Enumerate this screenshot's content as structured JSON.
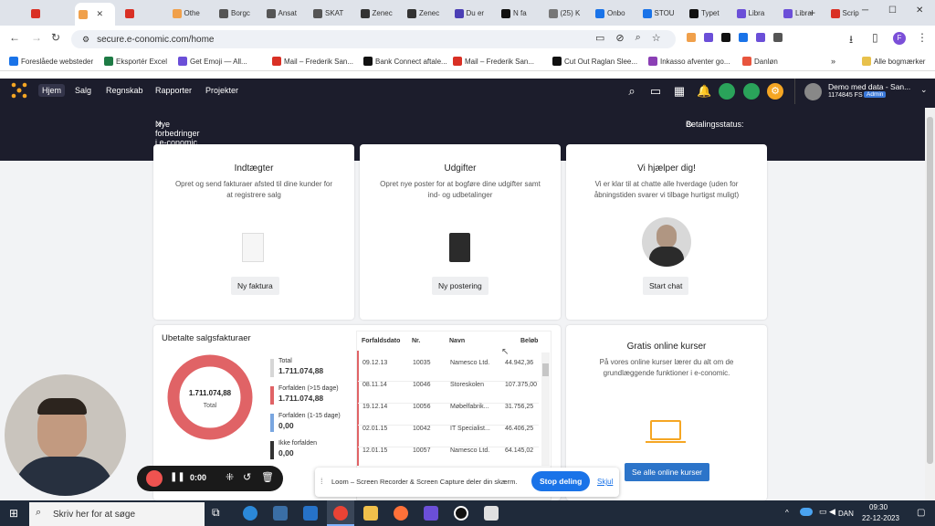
{
  "browser": {
    "tabs": [
      {
        "label": "",
        "icon": "gear-icon",
        "color": "#d93025"
      },
      {
        "label": "",
        "icon": "close-icon",
        "color": "#f0a04b"
      },
      {
        "label": "",
        "icon": "record-icon",
        "color": "#d93025"
      },
      {
        "label": "Othe",
        "icon": "office-icon",
        "color": "#f0a04b"
      },
      {
        "label": "Borgc",
        "icon": "link-icon",
        "color": "#555"
      },
      {
        "label": "Ansat",
        "icon": "link-icon",
        "color": "#555"
      },
      {
        "label": "SKAT",
        "icon": "link-icon",
        "color": "#555"
      },
      {
        "label": "Zenec",
        "icon": "zendesk-icon",
        "color": "#333"
      },
      {
        "label": "Zenec",
        "icon": "zendesk-icon",
        "color": "#333"
      },
      {
        "label": "Du er",
        "icon": "clover-icon",
        "color": "#4b3fb5"
      },
      {
        "label": "N fa",
        "icon": "n-icon",
        "color": "#111"
      },
      {
        "label": "(25) K",
        "icon": "globe-icon",
        "color": "#777"
      },
      {
        "label": "Onbo",
        "icon": "onboarding-icon",
        "color": "#1a73e8"
      },
      {
        "label": "STOU",
        "icon": "stou-icon",
        "color": "#1a73e8"
      },
      {
        "label": "Typet",
        "icon": "typeform-icon",
        "color": "#111"
      },
      {
        "label": "Libra",
        "icon": "library-icon",
        "color": "#6b4fd8"
      },
      {
        "label": "Libra",
        "icon": "library-icon",
        "color": "#6b4fd8"
      },
      {
        "label": "Scrip",
        "icon": "script-icon",
        "color": "#d93025"
      }
    ],
    "new_tab": "+",
    "url": "secure.e-conomic.com/home",
    "bookmarks": [
      {
        "label": "Foreslåede websteder",
        "icon": "e-icon",
        "color": "#1a73e8"
      },
      {
        "label": "Eksportér Excel",
        "icon": "excel-icon",
        "color": "#1e7b45"
      },
      {
        "label": "Get Emoji — All...",
        "icon": "emoji-icon",
        "color": "#6b4fd8"
      },
      {
        "label": "Mail – Frederik San...",
        "icon": "mail-icon",
        "color": "#d93025"
      },
      {
        "label": "Bank Connect aftale...",
        "icon": "n-icon",
        "color": "#111"
      },
      {
        "label": "Mail – Frederik San...",
        "icon": "mail-icon",
        "color": "#d93025"
      },
      {
        "label": "Cut Out Raglan Slee...",
        "icon": "s-icon",
        "color": "#111"
      },
      {
        "label": "Inkasso afventer go...",
        "icon": "clover-icon",
        "color": "#8b3fb5"
      },
      {
        "label": "Danløn",
        "icon": "danlon-icon",
        "color": "#e8553e"
      }
    ],
    "all_bookmarks": "Alle bogmærker"
  },
  "app": {
    "nav": [
      "Hjem",
      "Salg",
      "Regnskab",
      "Rapporter",
      "Projekter"
    ],
    "user_name": "Demo med data - San...",
    "user_id": "1174845 FS",
    "user_badge": "Admin",
    "news_link": "Nye forbedringer i e-conomic",
    "payment_status": "Betalingsstatus:"
  },
  "cards": {
    "income": {
      "title": "Indtægter",
      "desc": "Opret og send fakturaer afsted til dine kunder for at registrere salg",
      "button": "Ny faktura"
    },
    "expenses": {
      "title": "Udgifter",
      "desc": "Opret nye poster for at bogføre dine udgifter samt ind- og udbetalinger",
      "button": "Ny postering"
    },
    "help": {
      "title": "Vi hjælper dig!",
      "desc": "Vi er klar til at chatte alle hverdage (uden for åbningstiden svarer vi tilbage hurtigst muligt)",
      "button": "Start chat"
    },
    "courses": {
      "title": "Gratis online kurser",
      "desc": "På vores online kurser lærer du alt om de grundlæggende funktioner i e-conomic.",
      "button": "Se alle online kurser"
    }
  },
  "unpaid": {
    "title": "Ubetalte salgsfakturaer",
    "donut_value": "1.711.074,88",
    "donut_label": "Total",
    "legend": [
      {
        "label": "Total",
        "value": "1.711.074,88",
        "color": "#d6d6d6"
      },
      {
        "label": "Forfalden (>15 dage)",
        "value": "1.711.074,88",
        "color": "#e06366"
      },
      {
        "label": "Forfalden (1-15 dage)",
        "value": "0,00",
        "color": "#7aa6e0"
      },
      {
        "label": "Ikke forfalden",
        "value": "0,00",
        "color": "#333333"
      }
    ],
    "columns": [
      "Forfaldsdato",
      "Nr.",
      "Navn",
      "Beløb"
    ],
    "rows": [
      [
        "09.12.13",
        "10035",
        "Namesco Ltd.",
        "44.942,36"
      ],
      [
        "08.11.14",
        "10046",
        "Storeskolen",
        "107.375,00"
      ],
      [
        "19.12.14",
        "10056",
        "Møbelfabrik...",
        "31.756,25"
      ],
      [
        "02.01.15",
        "10042",
        "IT Specialist...",
        "46.406,25"
      ],
      [
        "12.01.15",
        "10057",
        "Namesco Ltd.",
        "64.145,02"
      ]
    ]
  },
  "loom": {
    "timer": "0:00",
    "share_text": "Loom – Screen Recorder & Screen Capture deler din skærm.",
    "stop": "Stop deling",
    "hide": "Skjul"
  },
  "taskbar": {
    "search": "Skriv her for at søge",
    "lang": "DAN",
    "time": "09:30",
    "date": "22-12-2023"
  }
}
